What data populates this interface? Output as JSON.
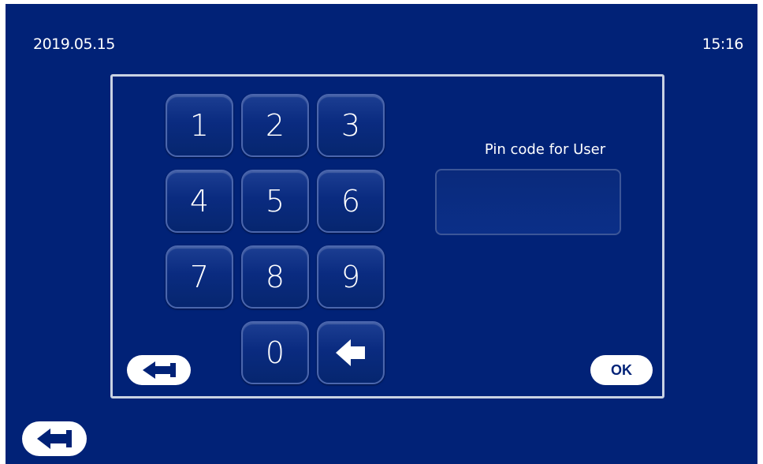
{
  "header": {
    "date": "2019.05.15",
    "time": "15:16"
  },
  "keypad": {
    "keys": [
      "1",
      "2",
      "3",
      "4",
      "5",
      "6",
      "7",
      "8",
      "9",
      "0"
    ],
    "backspace_icon": "left-arrow-icon"
  },
  "pin": {
    "label": "Pin code for User",
    "value": ""
  },
  "buttons": {
    "ok_label": "OK",
    "cancel_icon": "back-arrow-icon",
    "back_icon": "back-arrow-icon"
  },
  "colors": {
    "background": "#012277",
    "panel_border": "#c9d2e3",
    "text": "#ffffff"
  }
}
